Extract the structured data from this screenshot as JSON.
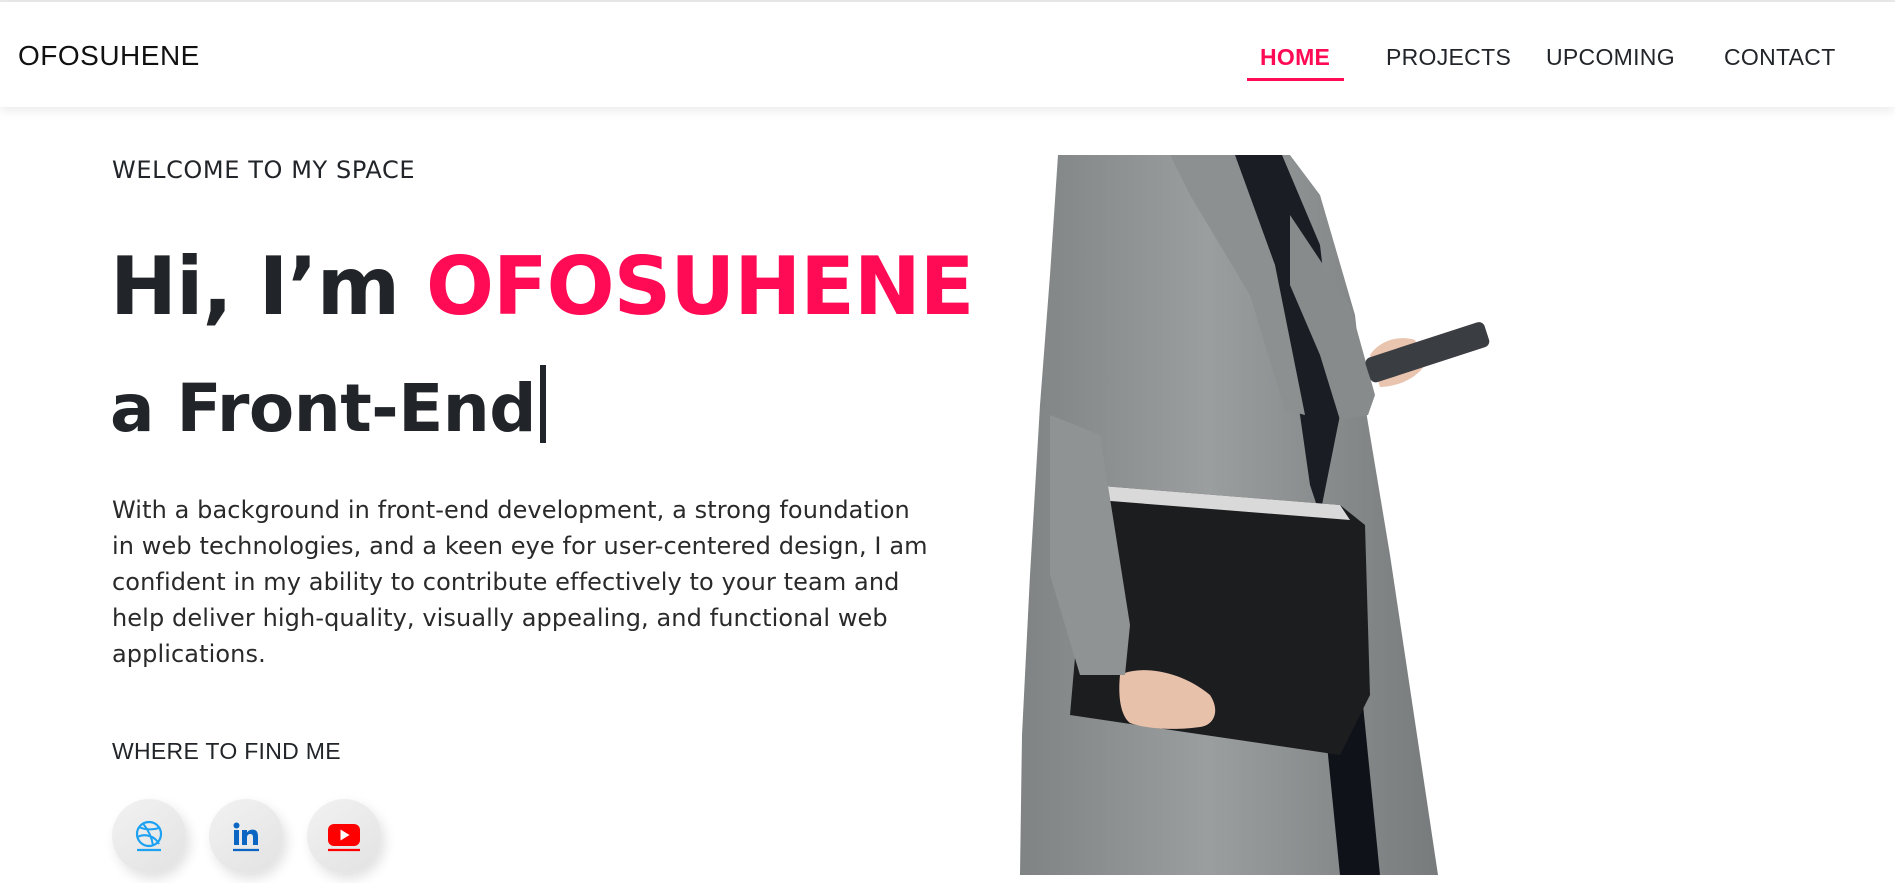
{
  "navbar": {
    "brand": "OFOSUHENE",
    "items": [
      {
        "label": "HOME",
        "active": true
      },
      {
        "label": "PROJECTS",
        "active": false
      },
      {
        "label": "UPCOMING",
        "active": false
      },
      {
        "label": "CONTACT",
        "active": false
      }
    ]
  },
  "hero": {
    "welcome": "WELCOME TO MY SPACE",
    "greeting": "Hi, I’m",
    "name": "OFOSUHENE",
    "subtitle": "a Front-End",
    "bio": "With a background in front-end development, a strong foundation in web technologies, and a keen eye for user-centered design, I am confident in my ability to contribute effectively to your team and help deliver high-quality, visually appealing, and functional web applications."
  },
  "find_me": {
    "heading": "WHERE TO FIND ME",
    "links": [
      {
        "icon": "dribbble-icon"
      },
      {
        "icon": "linkedin-icon"
      },
      {
        "icon": "youtube-icon"
      }
    ]
  },
  "colors": {
    "accent": "#ff0a54",
    "text": "#212529",
    "dribbble": "#1da1f2",
    "linkedin": "#0a66c2",
    "youtube": "#ff0000"
  }
}
